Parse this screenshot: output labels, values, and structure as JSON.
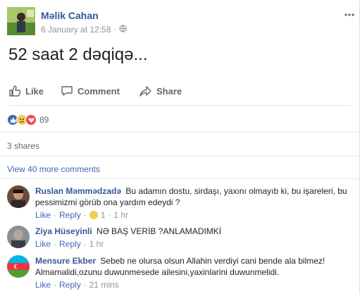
{
  "post": {
    "author": "Məlik Cahan",
    "timestamp": "6 January at 12:58",
    "privacy_icon": "globe-icon",
    "more_icon": "ellipsis-icon",
    "text": "52 saat 2 dəqiqə..."
  },
  "actions": {
    "like_label": "Like",
    "comment_label": "Comment",
    "share_label": "Share"
  },
  "reactions": {
    "types": [
      "like",
      "sad",
      "love"
    ],
    "count": "89"
  },
  "shares_text": "3 shares",
  "view_more_comments": "View 40 more comments",
  "comments": [
    {
      "author": "Ruslan Məmmədzadə",
      "text": "Bu adamın dostu, sirdaşı, yaxını olmayıb ki, bu işareleri, bu pessimizmi görüb ona yardım edeydi ?",
      "like": "Like",
      "reply": "Reply",
      "reaction_count": "1",
      "time": "1 hr"
    },
    {
      "author": "Ziya Hüseyinli",
      "text": "NƏ BAŞ VERİB ?ANLAMADIMKİ",
      "like": "Like",
      "reply": "Reply",
      "time": "1 hr"
    },
    {
      "author": "Mensure Ekber",
      "text": "Sebeb ne olursa olsun Allahin verdiyi cani bende ala bilmez! Almamalidi,ozunu duwunmesede ailesini,yaxinlarini duwunmelidi.",
      "like": "Like",
      "reply": "Reply",
      "time": "21 mins"
    }
  ],
  "separator": "·",
  "colors": {
    "link_blue": "#365899",
    "action_blue": "#4267b2",
    "meta_gray": "#90949c",
    "like_reaction": "#4267b2",
    "love_reaction": "#f0454d",
    "sad_reaction": "#f7cb4d"
  }
}
